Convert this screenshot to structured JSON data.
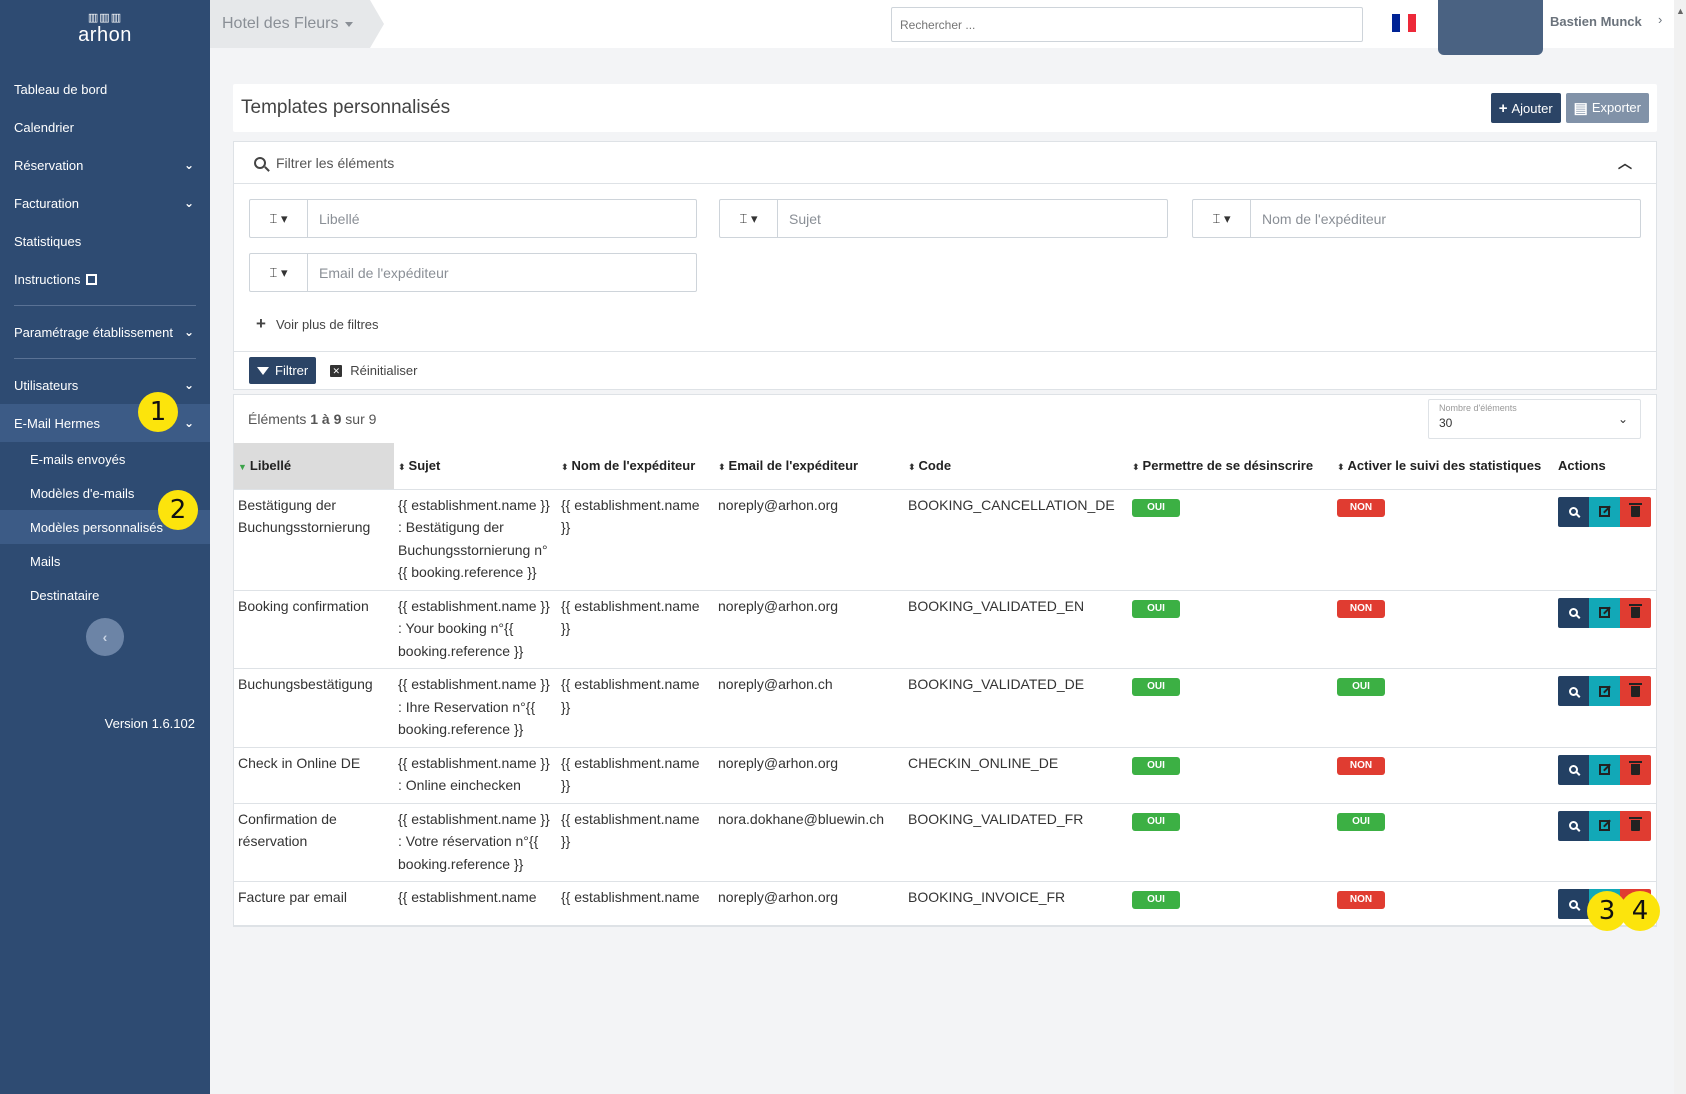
{
  "sidebar": {
    "logo_mark": "▥▥▥",
    "logo_text": "arhon",
    "items": [
      {
        "label": "Tableau de bord"
      },
      {
        "label": "Calendrier"
      },
      {
        "label": "Réservation"
      },
      {
        "label": "Facturation"
      },
      {
        "label": "Statistiques"
      },
      {
        "label": "Instructions"
      },
      {
        "label": "Paramétrage établissement"
      },
      {
        "label": "Utilisateurs"
      },
      {
        "label": "E-Mail Hermes"
      }
    ],
    "sub_items": [
      {
        "label": "E-mails envoyés"
      },
      {
        "label": "Modèles d'e-mails"
      },
      {
        "label": "Modèles personnalisés"
      },
      {
        "label": "Mails"
      },
      {
        "label": "Destinataire"
      }
    ],
    "collapse_icon": "‹",
    "version": "Version 1.6.102"
  },
  "badges": {
    "b1": "1",
    "b2": "2",
    "b3": "3",
    "b4": "4"
  },
  "topbar": {
    "hotel": "Hotel des Fleurs",
    "search_placeholder": "Rechercher ...",
    "flag_colors": [
      "#002395",
      "#ffffff",
      "#ed2939"
    ],
    "username": "Bastien Munck",
    "user_chevron": "›"
  },
  "page": {
    "title": "Templates personnalisés",
    "add_label": "Ajouter",
    "export_label": "Exporter"
  },
  "filters": {
    "header": "Filtrer les éléments",
    "operator_symbol": "⌶ ▾",
    "fields": [
      {
        "placeholder": "Libellé"
      },
      {
        "placeholder": "Sujet"
      },
      {
        "placeholder": "Nom de l'expéditeur"
      },
      {
        "placeholder": "Email de l'expéditeur"
      }
    ],
    "more_filters": "Voir plus de filtres",
    "filter_button": "Filtrer",
    "reset_button": "Réinitialiser"
  },
  "list": {
    "count_prefix": "Éléments ",
    "count_range_start": "1",
    "count_to": " à ",
    "count_range_end": "9",
    "count_suffix": " sur 9",
    "page_size_label": "Nombre d'éléments",
    "page_size_value": "30",
    "columns": [
      "Libellé",
      "Sujet",
      "Nom de l'expéditeur",
      "Email de l'expéditeur",
      "Code",
      "Permettre de se désinscrire",
      "Activer le suivi des statistiques",
      "Actions"
    ],
    "rows": [
      {
        "libelle": "Bestätigung der Buchungsstornierung",
        "sujet": "{{ establishment.name }} : Bestätigung der Buchungsstornierung n°{{ booking.reference }}",
        "nom": "{{ establishment.name }}",
        "email": "noreply@arhon.org",
        "code": "BOOKING_CANCELLATION_DE",
        "desinscrire": "OUI",
        "stats": "NON"
      },
      {
        "libelle": "Booking confirmation",
        "sujet": "{{ establishment.name }} : Your booking n°{{ booking.reference }}",
        "nom": "{{ establishment.name }}",
        "email": "noreply@arhon.org",
        "code": "BOOKING_VALIDATED_EN",
        "desinscrire": "OUI",
        "stats": "NON"
      },
      {
        "libelle": "Buchungsbestätigung",
        "sujet": "{{ establishment.name }} : Ihre Reservation n°{{ booking.reference }}",
        "nom": "{{ establishment.name }}",
        "email": "noreply@arhon.ch",
        "code": "BOOKING_VALIDATED_DE",
        "desinscrire": "OUI",
        "stats": "OUI"
      },
      {
        "libelle": "Check in Online DE",
        "sujet": "{{ establishment.name }} : Online einchecken",
        "nom": "{{ establishment.name }}",
        "email": "noreply@arhon.org",
        "code": "CHECKIN_ONLINE_DE",
        "desinscrire": "OUI",
        "stats": "NON"
      },
      {
        "libelle": "Confirmation de réservation",
        "sujet": "{{ establishment.name }} : Votre réservation n°{{ booking.reference }}",
        "nom": "{{ establishment.name }}",
        "email": "nora.dokhane@bluewin.ch",
        "code": "BOOKING_VALIDATED_FR",
        "desinscrire": "OUI",
        "stats": "OUI"
      },
      {
        "libelle": "Facture par email",
        "sujet": "{{ establishment.name",
        "nom": "{{ establishment.name",
        "email": "noreply@arhon.org",
        "code": "BOOKING_INVOICE_FR",
        "desinscrire": "OUI",
        "stats": "NON"
      }
    ]
  }
}
